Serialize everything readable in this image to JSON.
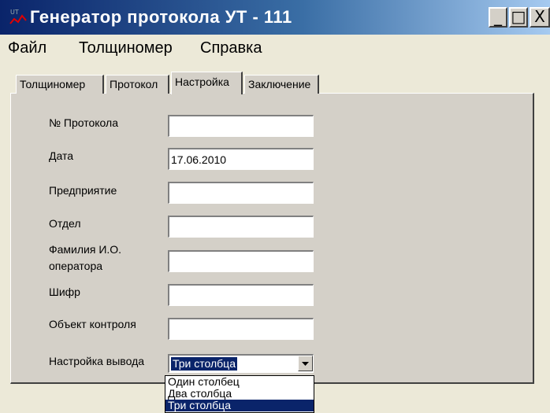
{
  "window": {
    "title": "Генератор протокола УТ - 111",
    "icon": "app-ut-icon",
    "controls": [
      "minimize-icon",
      "maximize-icon",
      "close-icon"
    ]
  },
  "menu": [
    "Файл",
    "Толщиномер",
    "Справка"
  ],
  "tabs": [
    "Толщиномер",
    "Протокол",
    "Настройка",
    "Заключение"
  ],
  "active_tab": "Настройка",
  "form": {
    "protocol_number": {
      "label": "№ Протокола",
      "value": ""
    },
    "date": {
      "label": "Дата",
      "value": "17.06.2010"
    },
    "enterprise": {
      "label": "Предприятие",
      "value": ""
    },
    "department": {
      "label": "Отдел",
      "value": ""
    },
    "operator": {
      "label_line1": "Фамилия И.О.",
      "label_line2": "оператора",
      "value": ""
    },
    "cipher": {
      "label": "Шифр",
      "value": ""
    },
    "control_object": {
      "label": "Объект контроля",
      "value": ""
    },
    "output_setting": {
      "label": "Настройка вывода",
      "value": "Три столбца",
      "options": [
        "Один столбец",
        "Два столбца",
        "Три столбца"
      ]
    }
  }
}
